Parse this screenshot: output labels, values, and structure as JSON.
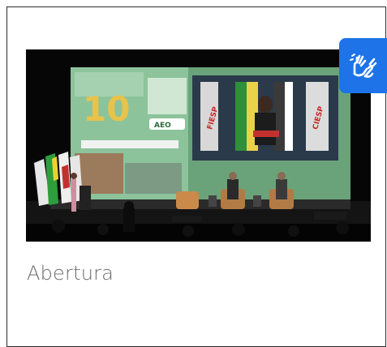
{
  "card": {
    "caption": "Abertura",
    "image_alt": "Abertura"
  },
  "accessibility_widget": {
    "icon": "sign-language-hands-icon",
    "color": "#1e73e8"
  },
  "photo_screen_text": {
    "left_panel_number": "10",
    "left_panel_logo": "AEO",
    "banner_left": "FIESP",
    "banner_right": "CIESP"
  },
  "colors": {
    "card_border": "#2b2b2b",
    "caption_text": "#6b6b6b",
    "screen_green": "#7fb88a"
  }
}
